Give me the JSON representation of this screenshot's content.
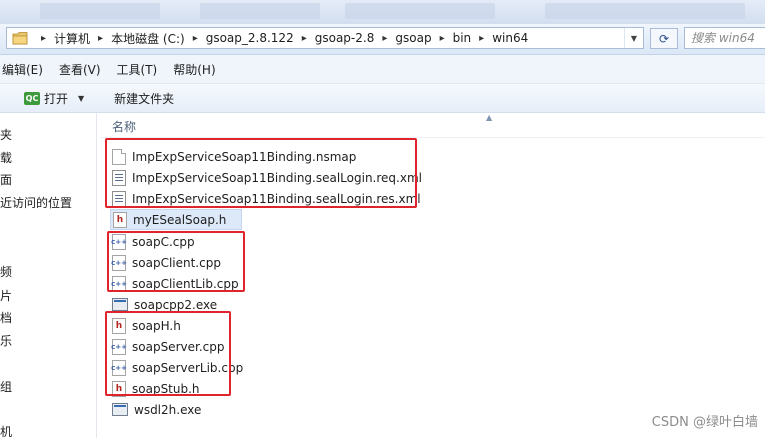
{
  "address": {
    "crumbs": [
      "计算机",
      "本地磁盘 (C:)",
      "gsoap_2.8.122",
      "gsoap-2.8",
      "gsoap",
      "bin",
      "win64"
    ],
    "search_placeholder": "搜索 win64"
  },
  "menu": [
    "编辑(E)",
    "查看(V)",
    "工具(T)",
    "帮助(H)"
  ],
  "toolbar": {
    "open_label": "打开",
    "qc_icon_text": "QC",
    "new_folder_label": "新建文件夹"
  },
  "navpane": {
    "items": [
      "夹",
      "载",
      "面",
      "近访问的位置",
      "频",
      "片",
      "档",
      "乐",
      "组",
      "机"
    ]
  },
  "filelist": {
    "column_name": "名称",
    "files": [
      {
        "name": "ImpExpServiceSoap11Binding.nsmap",
        "icon": "doc",
        "icon_text": ""
      },
      {
        "name": "ImpExpServiceSoap11Binding.sealLogin.req.xml",
        "icon": "xml",
        "icon_text": ""
      },
      {
        "name": "ImpExpServiceSoap11Binding.sealLogin.res.xml",
        "icon": "xml",
        "icon_text": ""
      },
      {
        "name": "myESealSoap.h",
        "icon": "h",
        "icon_text": "h",
        "selected": true
      },
      {
        "name": "soapC.cpp",
        "icon": "cpp",
        "icon_text": "c++"
      },
      {
        "name": "soapClient.cpp",
        "icon": "cpp",
        "icon_text": "c++"
      },
      {
        "name": "soapClientLib.cpp",
        "icon": "cpp",
        "icon_text": "c++"
      },
      {
        "name": "soapcpp2.exe",
        "icon": "exe",
        "icon_text": ""
      },
      {
        "name": "soapH.h",
        "icon": "h",
        "icon_text": "h"
      },
      {
        "name": "soapServer.cpp",
        "icon": "cpp",
        "icon_text": "c++"
      },
      {
        "name": "soapServerLib.cpp",
        "icon": "cpp",
        "icon_text": "c++"
      },
      {
        "name": "soapStub.h",
        "icon": "h",
        "icon_text": "h"
      },
      {
        "name": "wsdl2h.exe",
        "icon": "exe",
        "icon_text": ""
      }
    ]
  },
  "annotation_color": "#e0242b",
  "watermark": "CSDN @绿叶白墙"
}
